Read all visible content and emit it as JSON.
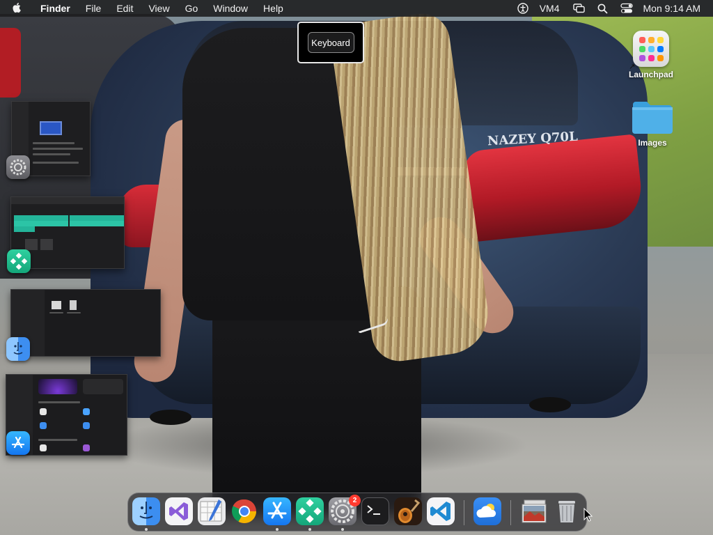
{
  "menubar": {
    "apple_icon": "apple-logo-icon",
    "app_name": "Finder",
    "menus": [
      "File",
      "Edit",
      "View",
      "Go",
      "Window",
      "Help"
    ],
    "status_icons": [
      "accessibility-icon",
      "screen-mirroring-icon",
      "spotlight-search-icon",
      "control-center-icon"
    ],
    "user_label": "VM4",
    "clock": "Mon 9:14 AM"
  },
  "keyboard_tooltip": {
    "label": "Keyboard"
  },
  "desktop": {
    "icons": [
      {
        "label": "Launchpad",
        "icon": "launchpad-icon"
      },
      {
        "label": "Images",
        "icon": "folder-icon"
      }
    ],
    "wallpaper_badge": "NAZEY Q70L"
  },
  "stage_manager": [
    {
      "app": "System Settings",
      "icon": "system-settings-icon"
    },
    {
      "app": "Bluetooth Utility",
      "icon": "app-icon-green-diamond"
    },
    {
      "app": "Finder",
      "icon": "finder-icon"
    },
    {
      "app": "App Store",
      "icon": "app-store-icon"
    }
  ],
  "dock": {
    "apps": [
      {
        "name": "Finder",
        "icon": "finder-icon",
        "running": true
      },
      {
        "name": "Visual Studio",
        "icon": "visual-studio-icon",
        "running": false
      },
      {
        "name": "Script Editor",
        "icon": "script-editor-icon",
        "running": false
      },
      {
        "name": "Google Chrome",
        "icon": "chrome-icon",
        "running": false
      },
      {
        "name": "App Store",
        "icon": "app-store-icon",
        "running": true
      },
      {
        "name": "Bluetooth Utility",
        "icon": "app-icon-green-diamond",
        "running": true
      },
      {
        "name": "System Settings",
        "icon": "system-settings-icon",
        "running": true,
        "badge": "2"
      },
      {
        "name": "Terminal",
        "icon": "terminal-icon",
        "running": false
      },
      {
        "name": "GarageBand",
        "icon": "garageband-icon",
        "running": false
      },
      {
        "name": "Visual Studio Code",
        "icon": "vscode-icon",
        "running": false
      },
      {
        "name": "Weather",
        "icon": "weather-icon",
        "running": false
      },
      {
        "name": "Image Stack",
        "icon": "image-stack-icon",
        "running": false
      },
      {
        "name": "Trash",
        "icon": "trash-icon",
        "running": false
      }
    ]
  },
  "colors": {
    "menubar_bg": "#1c1c1e",
    "badge_red": "#ff3b30",
    "folder_blue": "#4fb0e8"
  }
}
